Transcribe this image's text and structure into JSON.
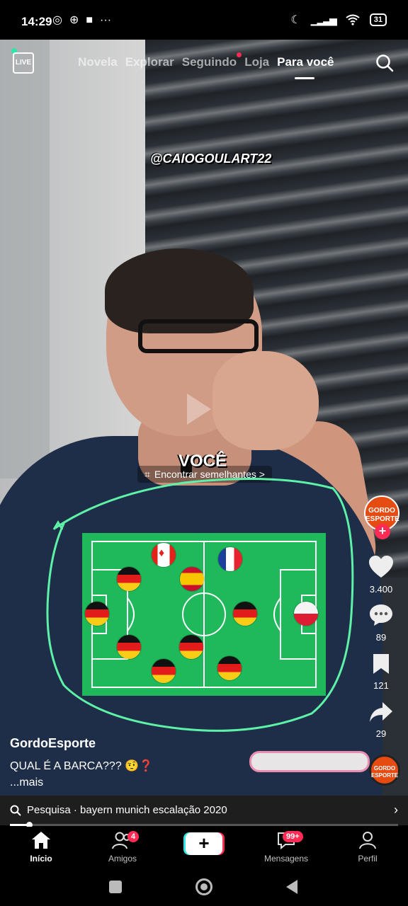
{
  "status_bar": {
    "time": "14:29",
    "battery": "31"
  },
  "top_nav": {
    "live_label": "LIVE",
    "tabs": [
      "Novela",
      "Explorar",
      "Seguindo",
      "Loja",
      "Para você"
    ],
    "active_tab": "Para você"
  },
  "video": {
    "watermark": "@CAIOGOULART22",
    "caption_overlay": "VOCÊ",
    "find_similar": "Encontrar semelhantes >",
    "formation_flags": [
      "Canada",
      "France",
      "Germany",
      "Spain",
      "Germany",
      "Germany",
      "Germany",
      "Poland",
      "Germany",
      "Germany",
      "Germany",
      "Germany"
    ]
  },
  "rail": {
    "avatar_text": "GORDO ESPORTE",
    "likes": "3.400",
    "comments": "89",
    "saves": "121",
    "shares": "29"
  },
  "post": {
    "author": "GordoEsporte",
    "description": "QUAL É A BARCA??? 🤨❓",
    "more": "...mais"
  },
  "search_suggestion": {
    "text": "Pesquisa · bayern munich escalação 2020"
  },
  "playback": {
    "progress": 0.05
  },
  "bottom_nav": {
    "home": "Início",
    "friends": "Amigos",
    "friends_badge": "4",
    "create": "+",
    "inbox": "Mensagens",
    "inbox_badge": "99+",
    "profile": "Perfil"
  },
  "colors": {
    "accent": "#fe2c55",
    "pitch": "#1fb85a",
    "scribble": "#5df2a8"
  }
}
